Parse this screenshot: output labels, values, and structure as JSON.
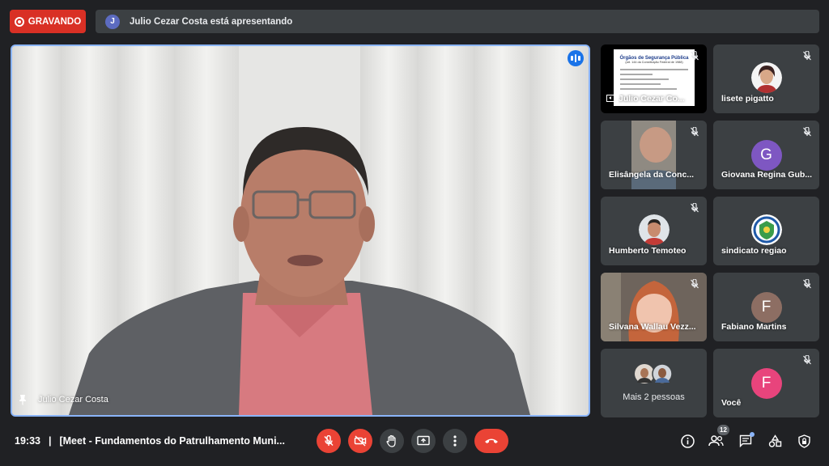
{
  "recording": {
    "label": "GRAVANDO"
  },
  "presenting": {
    "avatar_initial": "J",
    "text": "Julio Cezar Costa está apresentando"
  },
  "main_video": {
    "name": "Julio Cezar Costa"
  },
  "tiles": [
    {
      "name": "Julio Cezar Co...",
      "slide_title": "Órgãos de Segurança Pública",
      "slide_subtitle": "(art. 144 da Constituição Federal de 1988)"
    },
    {
      "name": "lisete pigatto"
    },
    {
      "name": "Elisângela da Conc..."
    },
    {
      "name": "Giovana Regina Gub...",
      "initial": "G",
      "color": "#7e57c2"
    },
    {
      "name": "Humberto Temoteo"
    },
    {
      "name": "sindicato regiao"
    },
    {
      "name": "Silvana Wallau Vezz..."
    },
    {
      "name": "Fabiano Martins",
      "initial": "F",
      "color": "#8d6e63"
    },
    {
      "name": "Mais 2 pessoas"
    },
    {
      "name": "Você",
      "initial": "F",
      "color": "#e8447c"
    }
  ],
  "bottom": {
    "time": "19:33",
    "separator": "|",
    "meeting_title": "[Meet - Fundamentos do Patrulhamento Muni...",
    "participants_count": "12"
  },
  "icons": {
    "mic_off": "mic-off-icon",
    "cam_off": "camera-off-icon",
    "hand": "raise-hand-icon",
    "present": "present-screen-icon",
    "more": "more-vert-icon",
    "hangup": "call-end-icon",
    "info": "info-icon",
    "people": "people-icon",
    "chat": "chat-icon",
    "activities": "activities-icon",
    "security": "host-controls-icon"
  },
  "colors": {
    "background": "#202124",
    "tile": "#3c4043",
    "accent_red": "#ea4335",
    "speaking_blue": "#1a73e8",
    "active_border": "#8ab4f8"
  }
}
